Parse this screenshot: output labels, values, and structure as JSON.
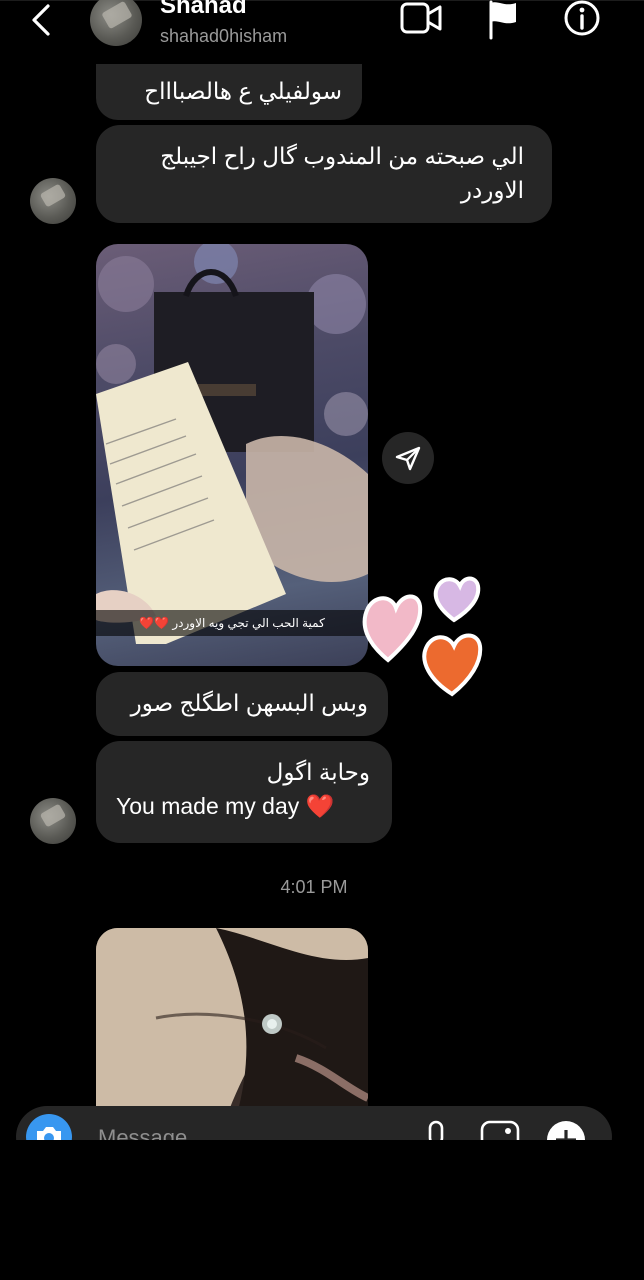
{
  "header": {
    "name": "Shahad",
    "username": "shahad0hisham"
  },
  "messages": [
    {
      "text": "سولفيلي ع هالصباااح"
    },
    {
      "text": "الي صبحته من المندوب گال راح اجيبلج الاوردر"
    },
    {
      "photo_caption": "كمية الحب الي تجي ويه الاوردر ❤️❤️"
    },
    {
      "text": "وبس البسهن اطگلج صور"
    },
    {
      "line1": "وحابة اگول",
      "line2": "You made my day ❤️"
    }
  ],
  "timestamp": "4:01 PM",
  "composer": {
    "placeholder": "Message"
  },
  "colors": {
    "background": "#000000",
    "bubble": "#262626",
    "camera_button": "#3897f0",
    "secondary_text": "#9a9a9a"
  }
}
